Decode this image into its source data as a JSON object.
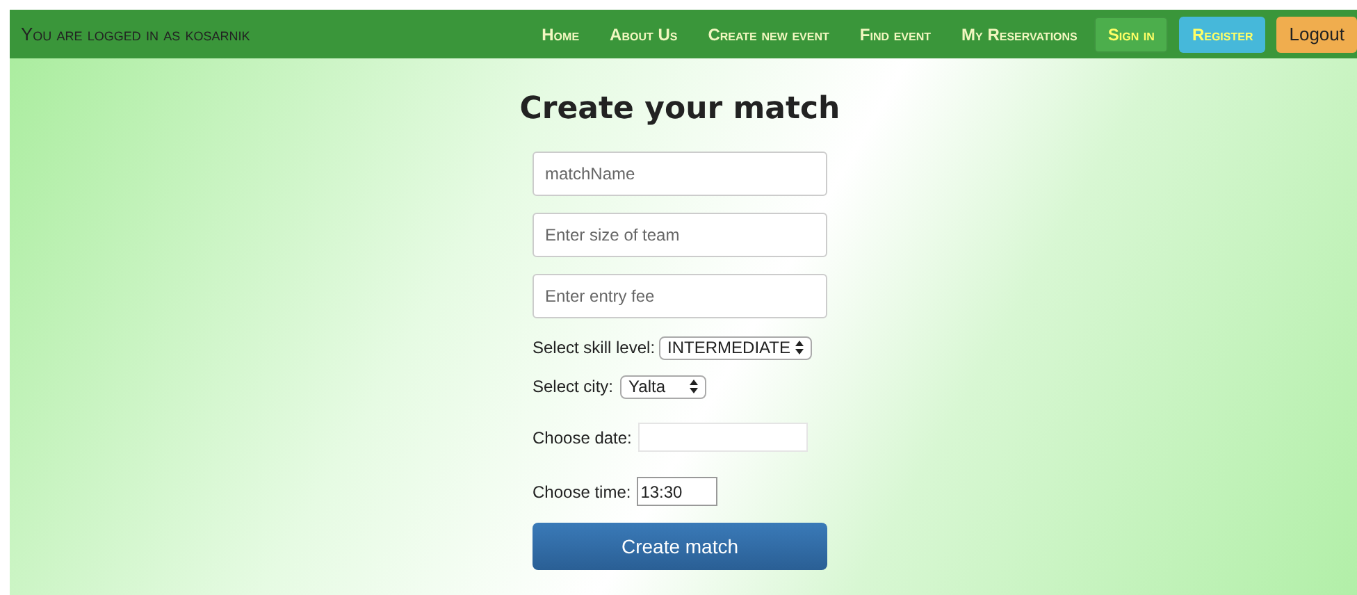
{
  "navbar": {
    "user_text": "You are logged in as kosarnik",
    "links": [
      {
        "label": "Home"
      },
      {
        "label": "About Us"
      },
      {
        "label": "Create new event"
      },
      {
        "label": "Find event"
      },
      {
        "label": "My Reservations"
      }
    ],
    "buttons": [
      {
        "label": "Sign in",
        "kind": "signin"
      },
      {
        "label": "Register",
        "kind": "register"
      },
      {
        "label": "Logout",
        "kind": "logout"
      }
    ]
  },
  "form": {
    "title": "Create your match",
    "fields": [
      {
        "placeholder": "matchName"
      },
      {
        "placeholder": "Enter size of team"
      },
      {
        "placeholder": "Enter entry fee"
      }
    ],
    "skill": {
      "label": "Select skill level:",
      "value": "INTERMEDIATE"
    },
    "city": {
      "label": "Select city:",
      "value": "Yalta"
    },
    "date": {
      "label": "Choose date:"
    },
    "time": {
      "label": "Choose time:",
      "value": "13:30"
    },
    "submit": "Create match"
  }
}
